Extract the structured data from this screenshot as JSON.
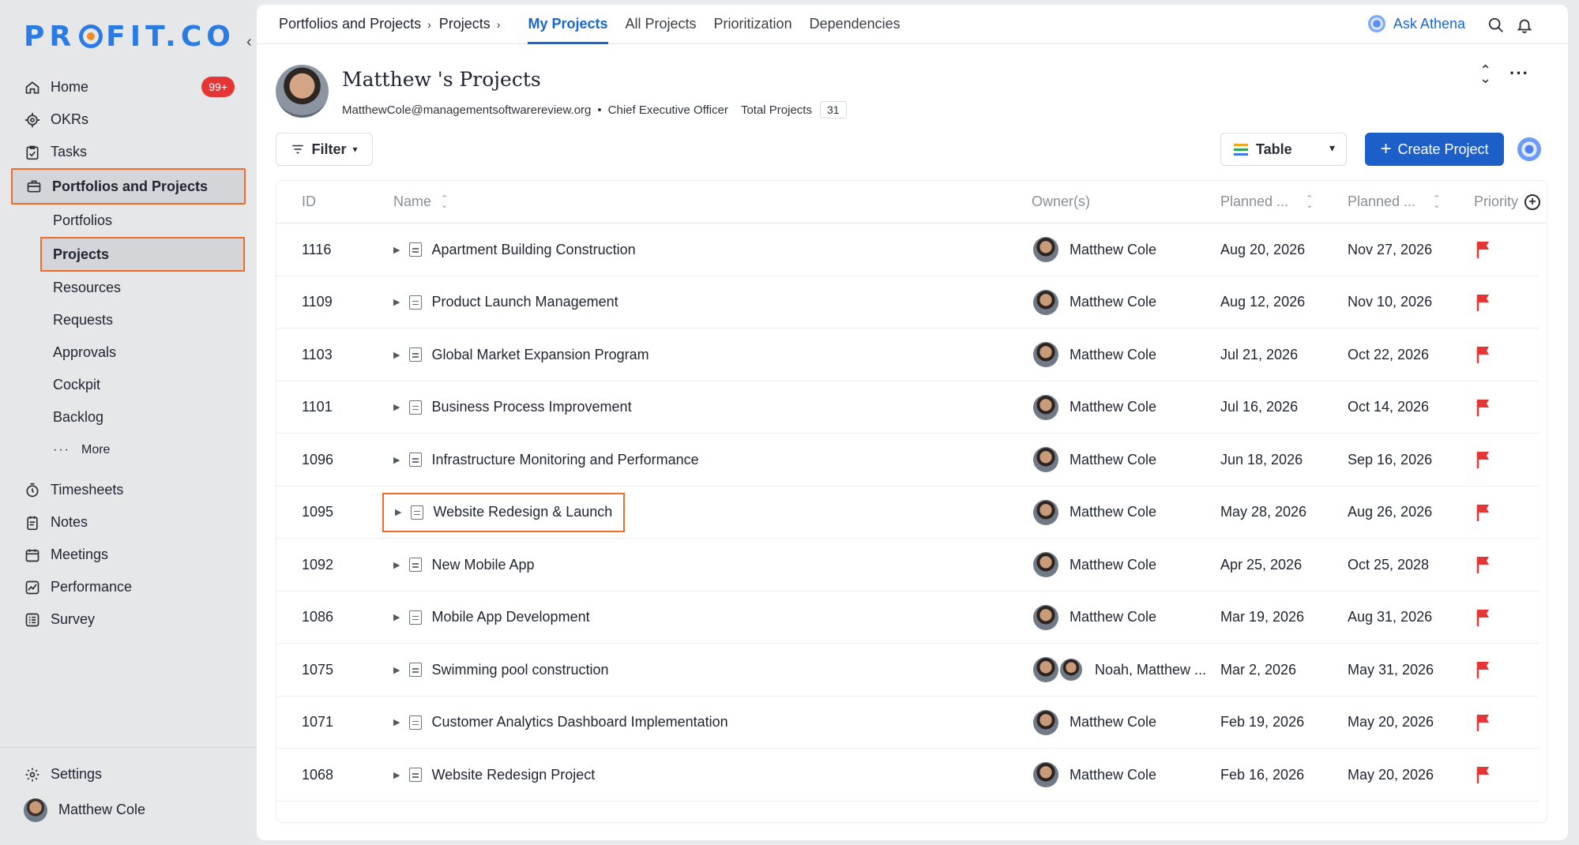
{
  "brand": {
    "logo_text_left": "PR",
    "logo_text_right": "FIT.CO"
  },
  "sidebar": {
    "collapse_glyph": "‹",
    "items": [
      {
        "label": "Home",
        "icon": "home-icon",
        "badge": "99+"
      },
      {
        "label": "OKRs",
        "icon": "target-icon"
      },
      {
        "label": "Tasks",
        "icon": "clipboard-check-icon"
      },
      {
        "label": "Portfolios and Projects",
        "icon": "briefcase-icon",
        "active": true
      }
    ],
    "sub_items": [
      "Portfolios",
      "Projects",
      "Resources",
      "Requests",
      "Approvals",
      "Cockpit",
      "Backlog"
    ],
    "more_label": "More",
    "lower_items": [
      {
        "label": "Timesheets",
        "icon": "stopwatch-icon"
      },
      {
        "label": "Notes",
        "icon": "notepad-icon"
      },
      {
        "label": "Meetings",
        "icon": "calendar-icon"
      },
      {
        "label": "Performance",
        "icon": "chart-icon"
      },
      {
        "label": "Survey",
        "icon": "survey-icon"
      }
    ],
    "settings_label": "Settings",
    "user_name": "Matthew Cole"
  },
  "topbar": {
    "breadcrumb": [
      "Portfolios and Projects",
      "Projects"
    ],
    "tabs": [
      "My Projects",
      "All Projects",
      "Prioritization",
      "Dependencies"
    ],
    "active_tab": "My Projects",
    "ask_label": "Ask Athena"
  },
  "profile": {
    "title": "Matthew 's Projects",
    "email": "MatthewCole@managementsoftwarereview.org",
    "role": "Chief Executive Officer",
    "total_label": "Total Projects",
    "total_count": "31"
  },
  "toolbar": {
    "filter_label": "Filter",
    "view_label": "Table",
    "create_label": "Create Project"
  },
  "table": {
    "columns": [
      "ID",
      "Name",
      "Owner(s)",
      "Planned ...",
      "Planned ...",
      "Priority"
    ],
    "rows": [
      {
        "id": "1116",
        "name": "Apartment Building Construction",
        "owner": "Matthew Cole",
        "start": "Aug 20, 2026",
        "end": "Nov 27, 2026"
      },
      {
        "id": "1109",
        "name": "Product Launch Management",
        "owner": "Matthew Cole",
        "start": "Aug 12, 2026",
        "end": "Nov 10, 2026"
      },
      {
        "id": "1103",
        "name": "Global Market Expansion Program",
        "owner": "Matthew Cole",
        "start": "Jul 21, 2026",
        "end": "Oct 22, 2026"
      },
      {
        "id": "1101",
        "name": "Business Process Improvement",
        "owner": "Matthew Cole",
        "start": "Jul 16, 2026",
        "end": "Oct 14, 2026"
      },
      {
        "id": "1096",
        "name": "Infrastructure Monitoring and Performance",
        "owner": "Matthew Cole",
        "start": "Jun 18, 2026",
        "end": "Sep 16, 2026"
      },
      {
        "id": "1095",
        "name": "Website Redesign & Launch",
        "owner": "Matthew Cole",
        "start": "May 28, 2026",
        "end": "Aug 26, 2026",
        "highlighted": true
      },
      {
        "id": "1092",
        "name": "New Mobile App",
        "owner": "Matthew Cole",
        "start": "Apr 25, 2026",
        "end": "Oct 25, 2028"
      },
      {
        "id": "1086",
        "name": "Mobile App Development",
        "owner": "Matthew Cole",
        "start": "Mar 19, 2026",
        "end": "Aug 31, 2026"
      },
      {
        "id": "1075",
        "name": "Swimming pool construction",
        "owner": "Noah, Matthew ...",
        "start": "Mar 2, 2026",
        "end": "May 31, 2026",
        "multi_owner": true
      },
      {
        "id": "1071",
        "name": "Customer Analytics Dashboard Implementation",
        "owner": "Matthew Cole",
        "start": "Feb 19, 2026",
        "end": "May 20, 2026"
      },
      {
        "id": "1068",
        "name": "Website Redesign Project",
        "owner": "Matthew Cole",
        "start": "Feb 16, 2026",
        "end": "May 20, 2026"
      }
    ]
  },
  "colors": {
    "accent": "#1a66d2",
    "highlight": "#f06a28",
    "flag": "#e53535",
    "badge": "#e53535"
  }
}
